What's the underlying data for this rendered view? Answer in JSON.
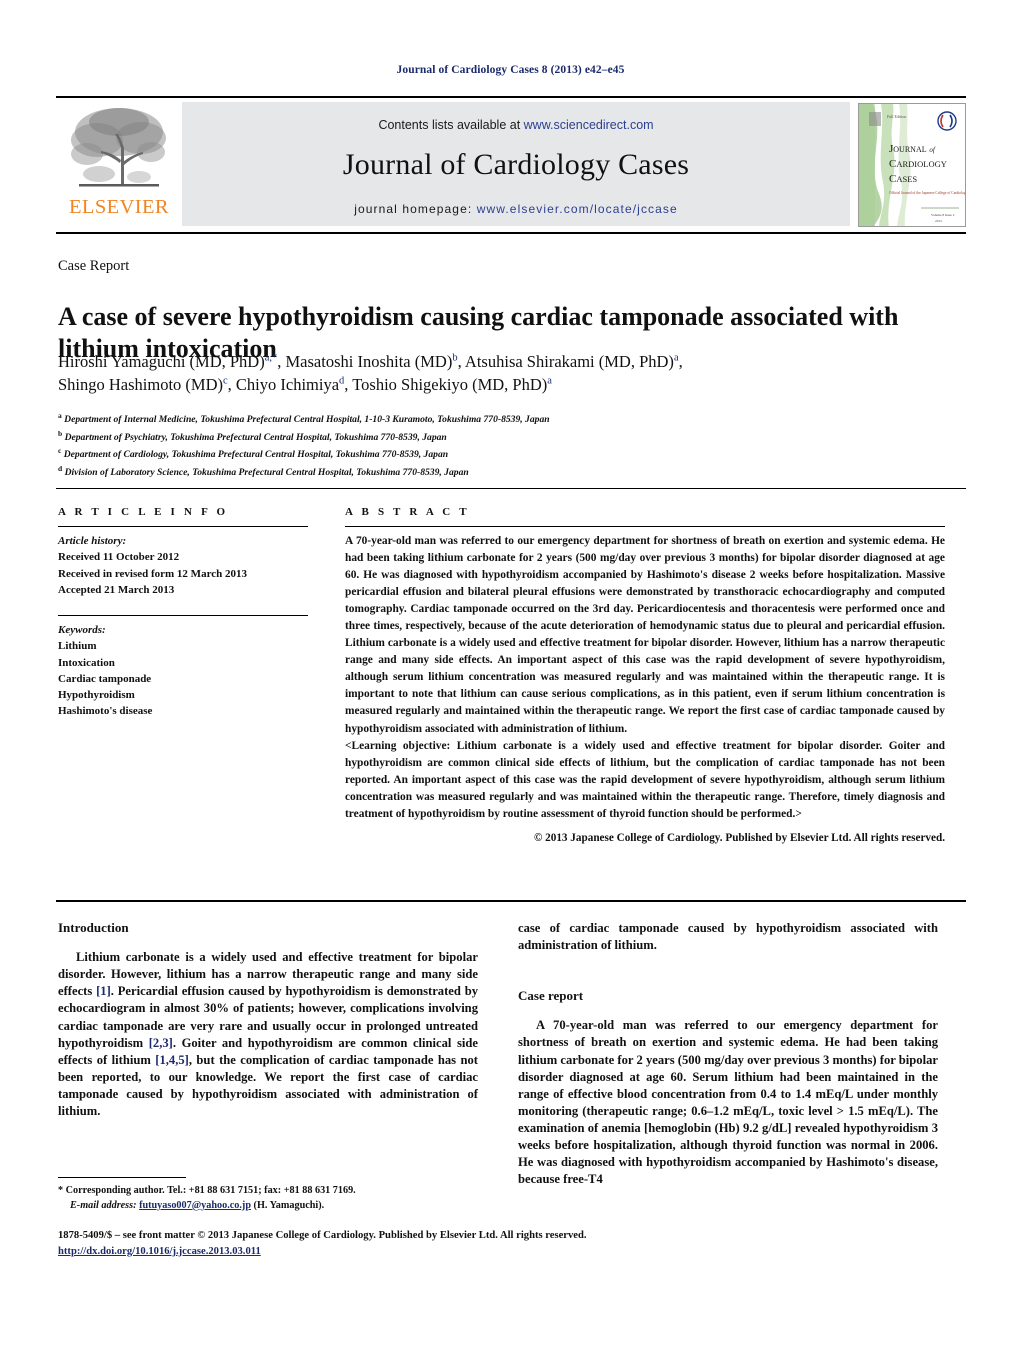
{
  "running_head": "Journal of Cardiology Cases 8 (2013) e42–e45",
  "masthead": {
    "contents_prefix": "Contents lists available at ",
    "contents_link": "www.sciencedirect.com",
    "journal_title": "Journal of Cardiology Cases",
    "homepage_prefix": "journal homepage: ",
    "homepage_link": "www.elsevier.com/locate/jccase",
    "publisher_wordmark": "ELSEVIER",
    "cover": {
      "small_top": "A Journal of the Japanese College of Cardiology",
      "line1": "Journal",
      "line1_of": "of",
      "line2": "Cardiology",
      "line3": "Cases",
      "tagline": "Official Journal of the Japanese College of Cardiology",
      "vol_line1": "Volume 8 Issue 2",
      "vol_line2": "2013"
    }
  },
  "article": {
    "type_label": "Case Report",
    "title": "A case of severe hypothyroidism causing cardiac tamponade associated with lithium intoxication",
    "authors_line1": "Hiroshi Yamaguchi (MD, PhD)",
    "authors_sup1": "a,*",
    "authors_line1b": ", Masatoshi Inoshita (MD)",
    "authors_sup2": "b",
    "authors_line1c": ", Atsuhisa Shirakami (MD, PhD)",
    "authors_sup3": "a",
    "authors_line1d": ",",
    "authors_line2": "Shingo Hashimoto (MD)",
    "authors_sup4": "c",
    "authors_line2b": ", Chiyo Ichimiya",
    "authors_sup5": "d",
    "authors_line2c": ", Toshio Shigekiyo (MD, PhD)",
    "authors_sup6": "a",
    "affiliations": [
      {
        "marker": "a",
        "text": "Department of Internal Medicine, Tokushima Prefectural Central Hospital, 1-10-3 Kuramoto, Tokushima 770-8539, Japan"
      },
      {
        "marker": "b",
        "text": "Department of Psychiatry, Tokushima Prefectural Central Hospital, Tokushima 770-8539, Japan"
      },
      {
        "marker": "c",
        "text": "Department of Cardiology, Tokushima Prefectural Central Hospital, Tokushima 770-8539, Japan"
      },
      {
        "marker": "d",
        "text": "Division of Laboratory Science, Tokushima Prefectural Central Hospital, Tokushima 770-8539, Japan"
      }
    ]
  },
  "article_info": {
    "heading": "A R T I C L E   I N F O",
    "history_label": "Article history:",
    "history": [
      "Received 11 October 2012",
      "Received in revised form 12 March 2013",
      "Accepted 21 March 2013"
    ],
    "keywords_label": "Keywords:",
    "keywords": [
      "Lithium",
      "Intoxication",
      "Cardiac tamponade",
      "Hypothyroidism",
      "Hashimoto's disease"
    ]
  },
  "abstract": {
    "heading": "A B S T R A C T",
    "body": "A 70-year-old man was referred to our emergency department for shortness of breath on exertion and systemic edema. He had been taking lithium carbonate for 2 years (500 mg/day over previous 3 months) for bipolar disorder diagnosed at age 60. He was diagnosed with hypothyroidism accompanied by Hashimoto's disease 2 weeks before hospitalization. Massive pericardial effusion and bilateral pleural effusions were demonstrated by transthoracic echocardiography and computed tomography. Cardiac tamponade occurred on the 3rd day. Pericardiocentesis and thoracentesis were performed once and three times, respectively, because of the acute deterioration of hemodynamic status due to pleural and pericardial effusion. Lithium carbonate is a widely used and effective treatment for bipolar disorder. However, lithium has a narrow therapeutic range and many side effects. An important aspect of this case was the rapid development of severe hypothyroidism, although serum lithium concentration was measured regularly and was maintained within the therapeutic range. It is important to note that lithium can cause serious complications, as in this patient, even if serum lithium concentration is measured regularly and maintained within the therapeutic range. We report the first case of cardiac tamponade caused by hypothyroidism associated with administration of lithium.",
    "learning_objective_label": "<Learning objective:",
    "learning_objective": " Lithium carbonate is a widely used and effective treatment for bipolar disorder. Goiter and hypothyroidism are common clinical side effects of lithium, but the complication of cardiac tamponade has not been reported. An important aspect of this case was the rapid development of severe hypothyroidism, although serum lithium concentration was measured regularly and was maintained within the therapeutic range. Therefore, timely diagnosis and treatment of hypothyroidism by routine assessment of thyroid function should be performed.>",
    "copyright": "© 2013 Japanese College of Cardiology. Published by Elsevier Ltd. All rights reserved."
  },
  "body": {
    "introduction_heading": "Introduction",
    "intro_p1_a": "Lithium carbonate is a widely used and effective treatment for bipolar disorder. However, lithium has a narrow therapeutic range and many side effects ",
    "intro_ref1": "[1]",
    "intro_p1_b": ". Pericardial effusion caused by hypothyroidism is demonstrated by echocardiogram in almost 30% of patients; however, complications involving cardiac tamponade are very rare and usually occur in prolonged untreated hypothyroidism ",
    "intro_ref2": "[2,3]",
    "intro_p1_c": ". Goiter and hypothyroidism are common clinical side effects of lithium ",
    "intro_ref3": "[1,4,5]",
    "intro_p1_d": ", but the complication of cardiac tamponade has not been reported, to our knowledge. We report the first case of cardiac tamponade caused by hypothyroidism associated with administration of lithium.",
    "case_report_heading": "Case report",
    "case_p1": "A 70-year-old man was referred to our emergency department for shortness of breath on exertion and systemic edema. He had been taking lithium carbonate for 2 years (500 mg/day over previous 3 months) for bipolar disorder diagnosed at age 60. Serum lithium had been maintained in the range of effective blood concentration from 0.4 to 1.4 mEq/L under monthly monitoring (therapeutic range; 0.6–1.2 mEq/L, toxic level > 1.5 mEq/L). The examination of anemia [hemoglobin (Hb) 9.2 g/dL] revealed hypothyroidism 3 weeks before hospitalization, although thyroid function was normal in 2006. He was diagnosed with hypothyroidism accompanied by Hashimoto's disease, because free-T4"
  },
  "footnotes": {
    "corresponding_marker": "*",
    "corresponding_text": "Corresponding author. Tel.: +81 88 631 7151; fax: +81 88 631 7169.",
    "email_label": "E-mail address:",
    "email_link": "futuyaso007@yahoo.co.jp",
    "email_suffix": " (H. Yamaguchi).",
    "issn_line": "1878-5409/$ – see front matter © 2013 Japanese College of Cardiology. Published by Elsevier Ltd. All rights reserved.",
    "doi_line": "http://dx.doi.org/10.1016/j.jccase.2013.03.011"
  },
  "colors": {
    "link_blue": "#2b3f91",
    "ref_blue": "#1b2a6b",
    "elsevier_orange": "#f08521",
    "banner_gray": "#e6e7e9"
  }
}
